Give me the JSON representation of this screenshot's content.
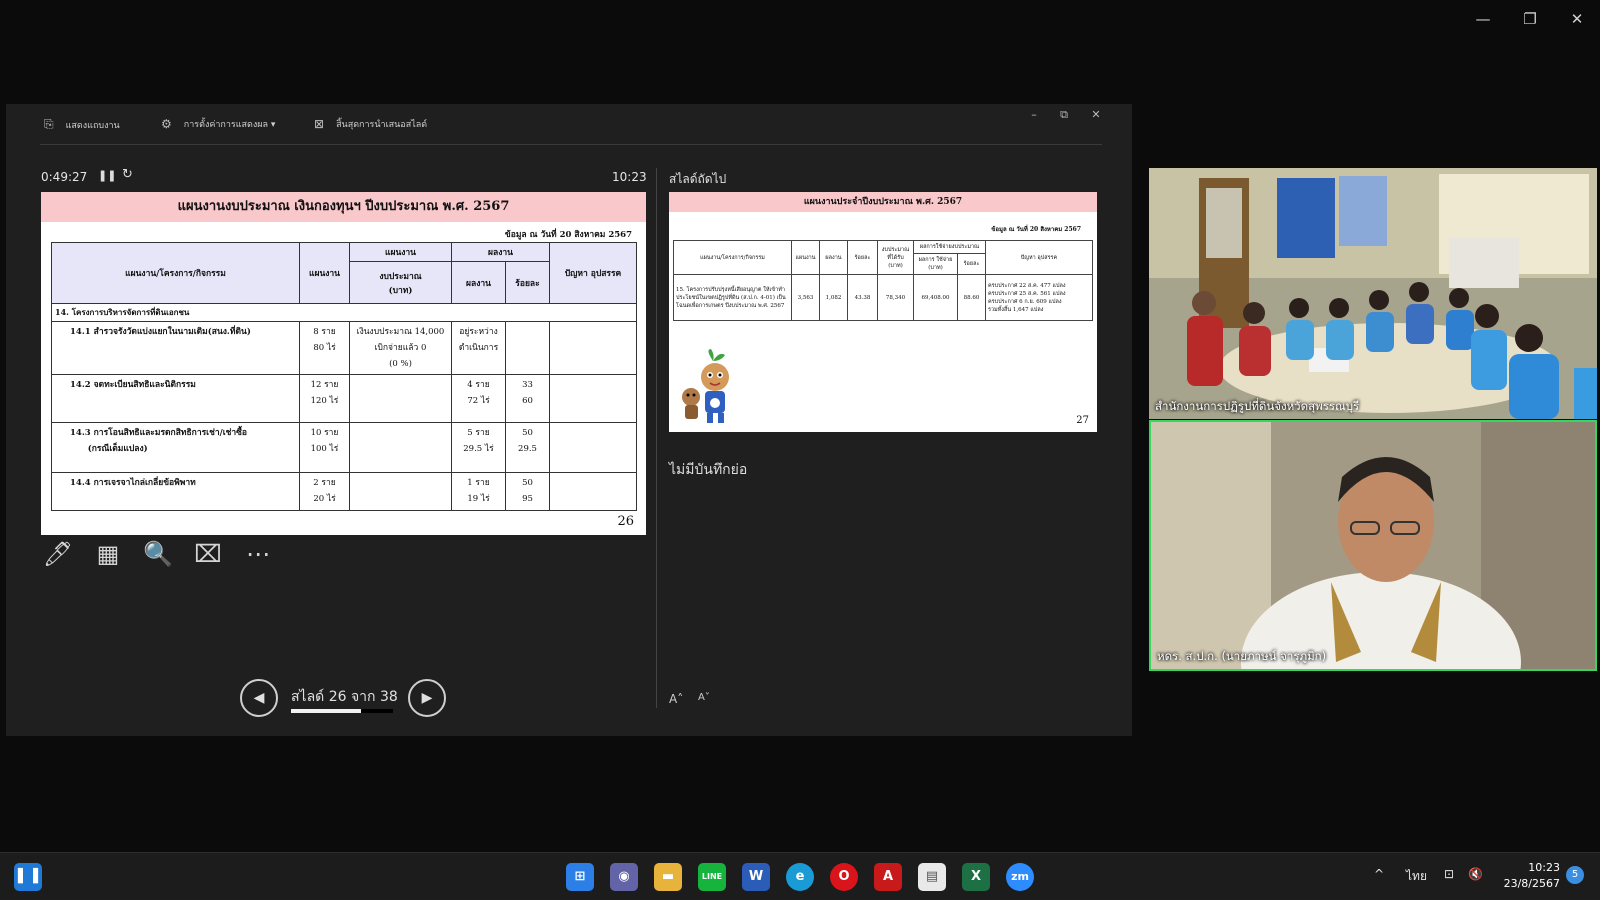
{
  "window_controls": {
    "minimize": "—",
    "restore": "❐",
    "close": "✕"
  },
  "presenter": {
    "toolbar": {
      "show_taskbar": "แสดงแถบงาน",
      "display_settings": "การตั้งค่าการแสดงผล ▾",
      "end_show": "สิ้นสุดการนำเสนอสไลด์"
    },
    "win_controls": {
      "minimize": "–",
      "restore": "⧉",
      "close": "✕"
    },
    "timer": "0:49:27",
    "clock": "10:23",
    "current_slide": {
      "title": "แผนงานงบประมาณ เงินกองทุนฯ ปีงบประมาณ พ.ศ. 2567",
      "date": "ข้อมูล ณ วันที่ 20 สิงหาคม 2567",
      "headers": {
        "project": "แผนงาน/โครงการ/กิจกรรม",
        "plan": "แผนงาน",
        "plan_group": "แผนงาน",
        "budget": "งบประมาณ\n(บาท)",
        "result_group": "ผลงาน",
        "result": "ผลงาน",
        "percent": "ร้อยละ",
        "problems": "ปัญหา อุปสรรค"
      },
      "section": "14. โครงการบริหารจัดการที่ดินเอกชน",
      "rows": [
        {
          "name": "14.1 สำรวจรังวัดแบ่งแยกในนามเดิม(สนง.ที่ดิน)",
          "plan": "8 ราย\n80 ไร่",
          "budget": "เงินงบประมาณ 14,000\nเบิกจ่ายแล้ว 0\n(0 %)",
          "result": "อยู่ระหว่าง\nดำเนินการ",
          "percent": ""
        },
        {
          "name": "14.2 จดทะเบียนสิทธิและนิติกรรม",
          "plan": "12 ราย\n120 ไร่",
          "budget": "",
          "result": "4 ราย\n72 ไร่",
          "percent": "33\n60"
        },
        {
          "name": "14.3 การโอนสิทธิและมรดกสิทธิการเช่า/เช่าซื้อ\n      (กรณีเต็มแปลง)",
          "plan": "10 ราย\n100 ไร่",
          "budget": "",
          "result": "5 ราย\n29.5 ไร่",
          "percent": "50\n29.5"
        },
        {
          "name": "14.4 การเจรจาไกล่เกลี่ยข้อพิพาท",
          "plan": "2 ราย\n20 ไร่",
          "budget": "",
          "result": "1 ราย\n19 ไร่",
          "percent": "50\n95"
        }
      ],
      "page_number": "26"
    },
    "tools": {
      "pen": "🖊",
      "all_slides": "▦",
      "zoom": "🔍",
      "screen": "⌧",
      "more": "⋯"
    },
    "nav": {
      "prev": "◀",
      "next": "▶",
      "slide_count": "สไลด์ 26 จาก 38",
      "progress": 0.684
    },
    "next_label": "สไลด์ถัดไป",
    "next_slide": {
      "title": "แผนงานประจำปีงบประมาณ พ.ศ. 2567",
      "date": "ข้อมูล ณ วันที่ 20 สิงหาคม 2567",
      "headers": {
        "project": "แผนงาน/โครงการ/กิจกรรม",
        "plan": "แผนงาน",
        "result": "ผลงาน",
        "percent": "ร้อยละ",
        "budget": "งบประมาณ ที่ได้รับ (บาท)",
        "spend_group": "ผลการใช้จ่ายงบประมาณ",
        "spent": "ผลการ ใช้จ่าย (บาท)",
        "spent_pct": "ร้อยละ",
        "problems": "ปัญหา อุปสรรค"
      },
      "row": {
        "name": "15. โครงการปรับปรุงหนี้เสียอนุญาต ให้เข้าทำประโยชน์ในเขตปฏิรูปที่ดิน (ส.ป.ก. 4-01) เป็นโฉนดเพื่อการเกษตร ปีงบประมาณ พ.ศ. 2567",
        "plan": "3,563",
        "result": "1,082",
        "percent": "43.38",
        "budget": "78,340",
        "spent": "69,408.00",
        "spent_pct": "88.60",
        "problems": "ครบประกาศ 22 ส.ค. 477 แปลง\nครบประกาศ 25 ส.ค. 561 แปลง\nครบประกาศ 6 ก.ย. 609 แปลง\nรวมทั้งสิ้น 1,647 แปลง"
      },
      "page_number": "27"
    },
    "notes": "ไม่มีบันทึกย่อ",
    "font_increase": "A˄",
    "font_decrease": "A˅"
  },
  "videos": [
    {
      "label": "สำนักงานการปฏิรูปที่ดินจังหวัดสุพรรณบุรี"
    },
    {
      "label": "หดร. ส.ป.ก. (นายภาษน์  จารุภูมิก)"
    }
  ],
  "taskbar": {
    "apps": [
      {
        "name": "start",
        "glyph": "⊞",
        "color": "#2b7fe6"
      },
      {
        "name": "teams",
        "glyph": "◉",
        "color": "#6264a7"
      },
      {
        "name": "files",
        "glyph": "▬",
        "color": "#e8b33a"
      },
      {
        "name": "line",
        "glyph": "LINE",
        "color": "#16b33d"
      },
      {
        "name": "word",
        "glyph": "W",
        "color": "#2b5cb8"
      },
      {
        "name": "edge",
        "glyph": "e",
        "color": "#1a9bd6"
      },
      {
        "name": "opera",
        "glyph": "O",
        "color": "#d9141b"
      },
      {
        "name": "acrobat",
        "glyph": "A",
        "color": "#c81a1a"
      },
      {
        "name": "notepad",
        "glyph": "▤",
        "color": "#e9e9e9"
      },
      {
        "name": "excel",
        "glyph": "X",
        "color": "#1d7044"
      },
      {
        "name": "zoom",
        "glyph": "zm",
        "color": "#2d8cff"
      }
    ],
    "tray": {
      "chevron": "^",
      "language": "ไทย",
      "network": "⊡",
      "volume": "🔇",
      "time": "10:23",
      "date": "23/8/2567",
      "notifications": "5"
    }
  }
}
